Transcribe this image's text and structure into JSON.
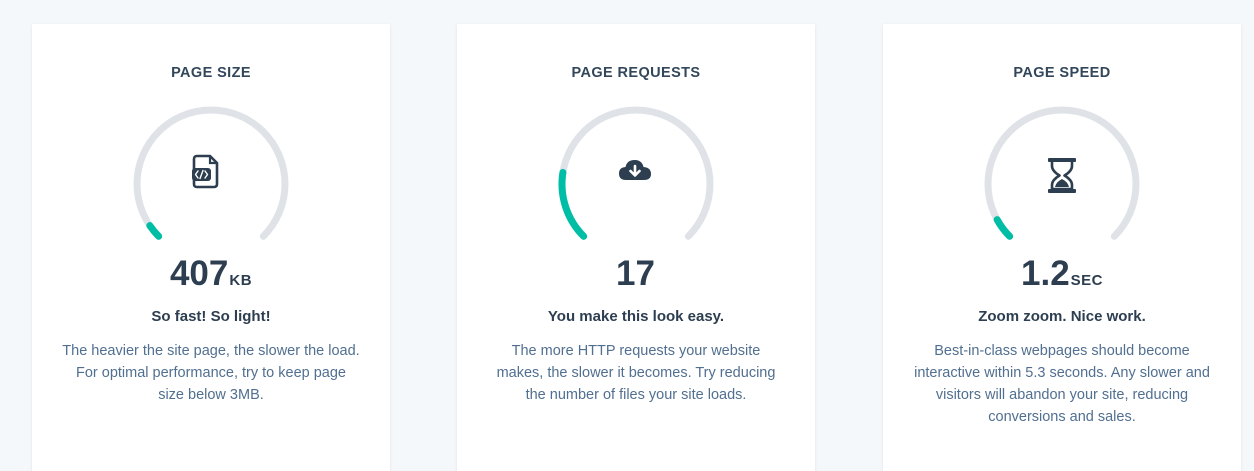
{
  "colors": {
    "track": "#dfe3e8",
    "progress": "#00bda5",
    "icon": "#2d3e50"
  },
  "cards": [
    {
      "title": "PAGE SIZE",
      "icon": "code-file-icon",
      "value": "407",
      "unit": "KB",
      "headline": "So fast! So light!",
      "description": "The heavier the site page, the slower the load. For optimal performance, try to keep page size below 3MB.",
      "gauge_fill": 0.04
    },
    {
      "title": "PAGE REQUESTS",
      "icon": "cloud-download-icon",
      "value": "17",
      "unit": "",
      "headline": "You make this look easy.",
      "description": "The more HTTP requests your website makes, the slower it becomes. Try reducing the number of files your site loads.",
      "gauge_fill": 0.2
    },
    {
      "title": "PAGE SPEED",
      "icon": "hourglass-icon",
      "value": "1.2",
      "unit": "SEC",
      "headline": "Zoom zoom. Nice work.",
      "description": "Best-in-class webpages should become interactive within 5.3 seconds. Any slower and visitors will abandon your site, reducing conversions and sales.",
      "gauge_fill": 0.06
    }
  ]
}
